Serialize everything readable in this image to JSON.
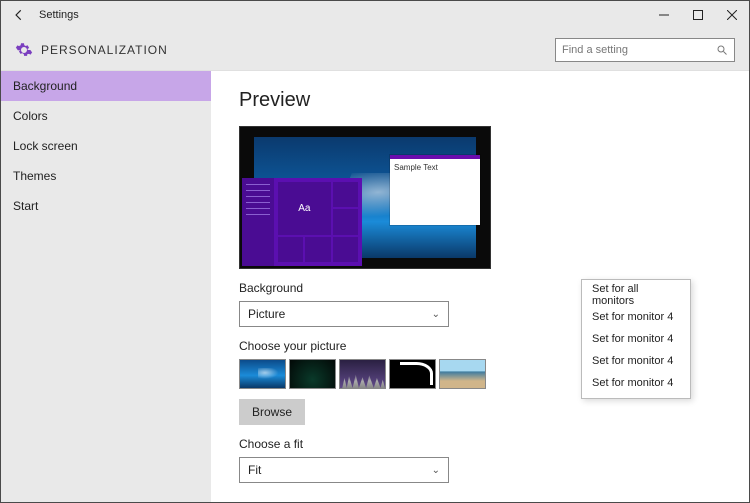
{
  "titlebar": {
    "title": "Settings"
  },
  "header": {
    "title": "PERSONALIZATION",
    "search_placeholder": "Find a setting"
  },
  "sidebar": {
    "items": [
      {
        "label": "Background",
        "active": true
      },
      {
        "label": "Colors"
      },
      {
        "label": "Lock screen"
      },
      {
        "label": "Themes"
      },
      {
        "label": "Start"
      }
    ]
  },
  "main": {
    "preview_heading": "Preview",
    "sample_text": "Sample Text",
    "tile_aa": "Aa",
    "background_label": "Background",
    "background_value": "Picture",
    "choose_picture_label": "Choose your picture",
    "browse_label": "Browse",
    "choose_fit_label": "Choose a fit",
    "fit_value": "Fit"
  },
  "context_menu": {
    "items": [
      "Set for all monitors",
      "Set for monitor 4",
      "Set for monitor 4",
      "Set for monitor 4",
      "Set for monitor 4"
    ]
  },
  "colors": {
    "accent": "#6a0dad",
    "sidebar_active": "#c7a6e8"
  }
}
